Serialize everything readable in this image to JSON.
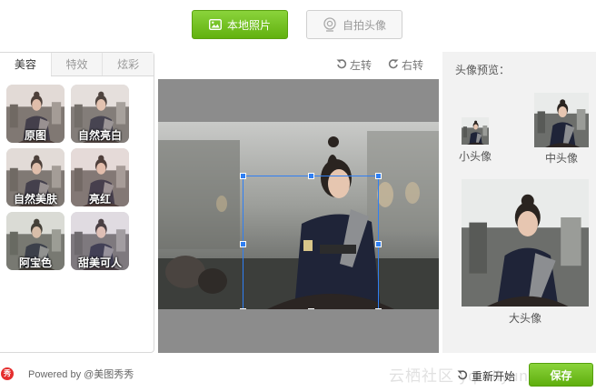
{
  "top_buttons": {
    "local_photo": "本地照片",
    "selfie": "自拍头像"
  },
  "tabs": [
    "美容",
    "特效",
    "炫彩"
  ],
  "filters": [
    {
      "label": "原图",
      "tint": "#caa090"
    },
    {
      "label": "自然亮白",
      "tint": "#d8b8ae"
    },
    {
      "label": "自然美肤",
      "tint": "#c8a596"
    },
    {
      "label": "亮红",
      "tint": "#d89e9a"
    },
    {
      "label": "阿宝色",
      "tint": "#a6a48c"
    },
    {
      "label": "甜美可人",
      "tint": "#bda2c2"
    }
  ],
  "toolbar": {
    "rotate_left": "左转",
    "rotate_right": "右转"
  },
  "preview": {
    "title": "头像预览：",
    "small": "小头像",
    "medium": "中头像",
    "large": "大头像"
  },
  "footer": {
    "logo_text": "秀",
    "powered_by": "Powered by @美图秀秀",
    "restart": "重新开始",
    "save": "保存",
    "watermark": "云栖社区 yq.aliyun.com"
  },
  "colors": {
    "accent_green": "#6cbe1a",
    "crop_blue": "#2f7ff3"
  }
}
